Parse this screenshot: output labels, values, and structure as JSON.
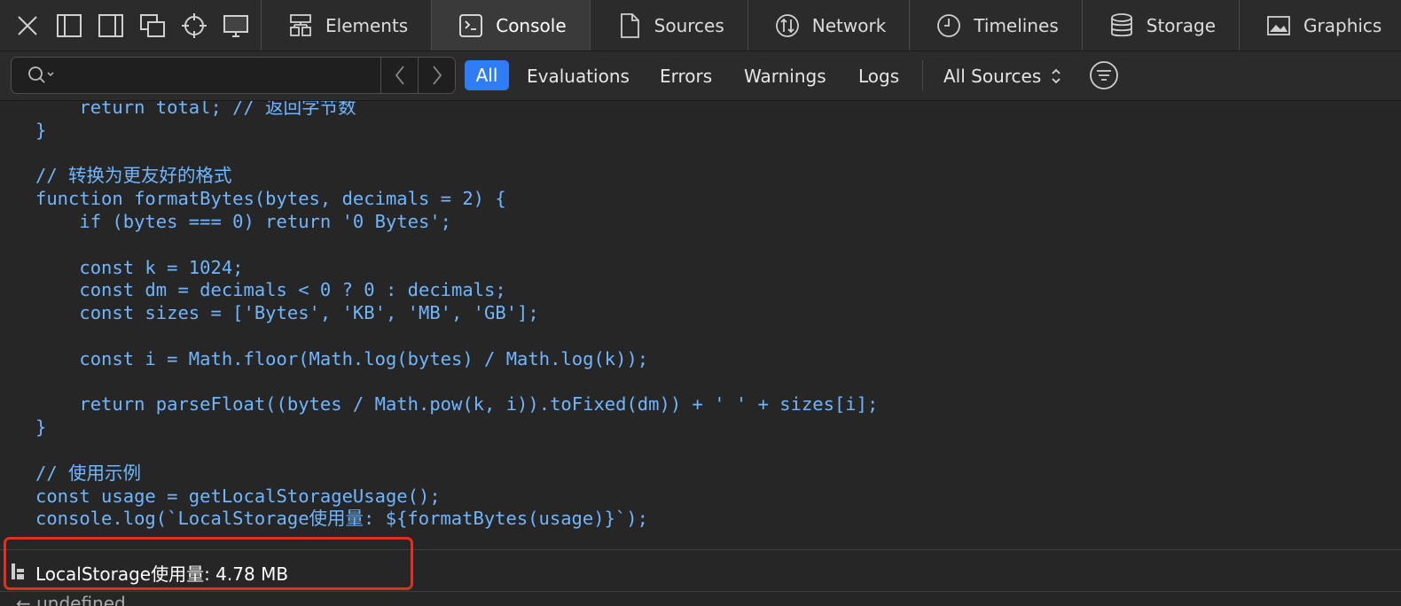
{
  "tabs": [
    {
      "label": "Elements",
      "icon": "elements-icon"
    },
    {
      "label": "Console",
      "icon": "console-icon",
      "active": true
    },
    {
      "label": "Sources",
      "icon": "sources-icon"
    },
    {
      "label": "Network",
      "icon": "network-icon"
    },
    {
      "label": "Timelines",
      "icon": "timelines-icon"
    },
    {
      "label": "Storage",
      "icon": "storage-icon"
    },
    {
      "label": "Graphics",
      "icon": "graphics-icon"
    }
  ],
  "toolbar_icons": [
    "close-icon",
    "dock-left-icon",
    "dock-right-icon",
    "detach-window-icon",
    "inspect-target-icon",
    "device-icon"
  ],
  "filters": {
    "search_placeholder": "",
    "all": "All",
    "evaluations": "Evaluations",
    "errors": "Errors",
    "warnings": "Warnings",
    "logs": "Logs",
    "sources_select": "All Sources"
  },
  "code_lines": [
    "    return total; // 返回字节数",
    "}",
    "",
    "// 转换为更友好的格式",
    "function formatBytes(bytes, decimals = 2) {",
    "    if (bytes === 0) return '0 Bytes';",
    "",
    "    const k = 1024;",
    "    const dm = decimals < 0 ? 0 : decimals;",
    "    const sizes = ['Bytes', 'KB', 'MB', 'GB'];",
    "",
    "    const i = Math.floor(Math.log(bytes) / Math.log(k));",
    "",
    "    return parseFloat((bytes / Math.pow(k, i)).toFixed(dm)) + ' ' + sizes[i];",
    "}",
    "",
    "// 使用示例",
    "const usage = getLocalStorageUsage();",
    "console.log(`LocalStorage使用量: ${formatBytes(usage)}`);"
  ],
  "result": {
    "text": "LocalStorage使用量: 4.78 MB"
  },
  "next_line": "← undefined",
  "colors": {
    "accent": "#2e7cf6",
    "code": "#6fb6ff",
    "highlight": "#e0301e"
  }
}
